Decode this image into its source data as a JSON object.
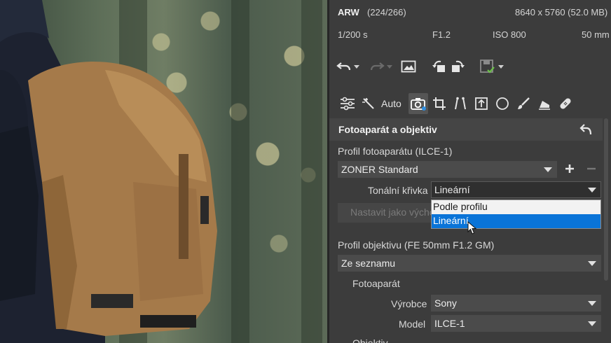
{
  "image_info": {
    "format": "ARW",
    "index": "(224/266)",
    "dimensions": "8640 x 5760 (52.0 MB)",
    "shutter": "1/200 s",
    "aperture": "F1.2",
    "iso": "ISO 800",
    "focal_length": "50 mm"
  },
  "toolbar": {
    "icons": [
      "undo-icon",
      "redo-icon",
      "image-icon",
      "rotate-left-icon",
      "rotate-right-icon",
      "save-icon"
    ]
  },
  "tools": {
    "icons": [
      "sliders-icon",
      "magic-wand-icon",
      "camera-icon",
      "crop-icon",
      "perspective-icon",
      "text-frame-icon",
      "circle-icon",
      "brush-icon",
      "eraser-icon",
      "bandage-icon"
    ],
    "auto_label": "Auto"
  },
  "section": {
    "title": "Fotoaparát a objektiv"
  },
  "camera_profile": {
    "label": "Profil fotoaparátu (ILCE-1)",
    "selected": "ZONER Standard",
    "tonal_curve_label": "Tonální křivka",
    "tonal_curve_value": "Lineární",
    "set_default_label": "Nastavit jako výchozí",
    "dropdown_options": [
      "Podle profilu",
      "Lineární"
    ]
  },
  "lens_profile": {
    "label": "Profil objektivu (FE 50mm F1.2 GM)",
    "selected": "Ze seznamu",
    "camera_group_label": "Fotoaparát",
    "manufacturer_label": "Výrobce",
    "manufacturer_value": "Sony",
    "model_label": "Model",
    "model_value": "ILCE-1",
    "lens_group_label": "Objektiv"
  },
  "colors": {
    "panel_bg": "#3c3c3c",
    "selection_blue": "#0a74d8",
    "dropdown_bg": "#f2f2f2"
  }
}
